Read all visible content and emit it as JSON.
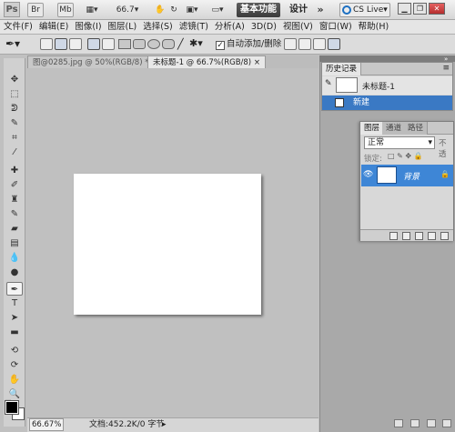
{
  "app": {
    "logo": "Ps",
    "zoom_value": "66.7",
    "workspace_active": "基本功能",
    "workspace_design": "设计",
    "more": "»",
    "cs_live": "CS Live"
  },
  "menu": [
    "文件(F)",
    "编辑(E)",
    "图像(I)",
    "图层(L)",
    "选择(S)",
    "滤镜(T)",
    "分析(A)",
    "3D(D)",
    "视图(V)",
    "窗口(W)",
    "帮助(H)"
  ],
  "options": {
    "auto_add_delete": "自动添加/删除",
    "auto_add_checked": true
  },
  "documents": {
    "tabs": [
      {
        "label": "图@0285.jpg @ 50%(RGB/8) *",
        "active": false
      },
      {
        "label": "未标题-1 @ 66.7%(RGB/8)",
        "active": true
      }
    ]
  },
  "status": {
    "zoom": "66.67%",
    "doc_info": "文档:452.2K/0 字节"
  },
  "history": {
    "tab": "历史记录",
    "snapshot": "未标题-1",
    "step": "新建"
  },
  "layers": {
    "tabs": [
      "图层",
      "通道",
      "路径"
    ],
    "blend_mode": "正常",
    "opacity_label": "不透",
    "lock_label": "锁定:",
    "layer_name": "背景"
  },
  "colors": {
    "selection_blue": "#3a79c4",
    "layer_blue": "#3e86d6",
    "workspace_bg": "#c0c0c0"
  }
}
